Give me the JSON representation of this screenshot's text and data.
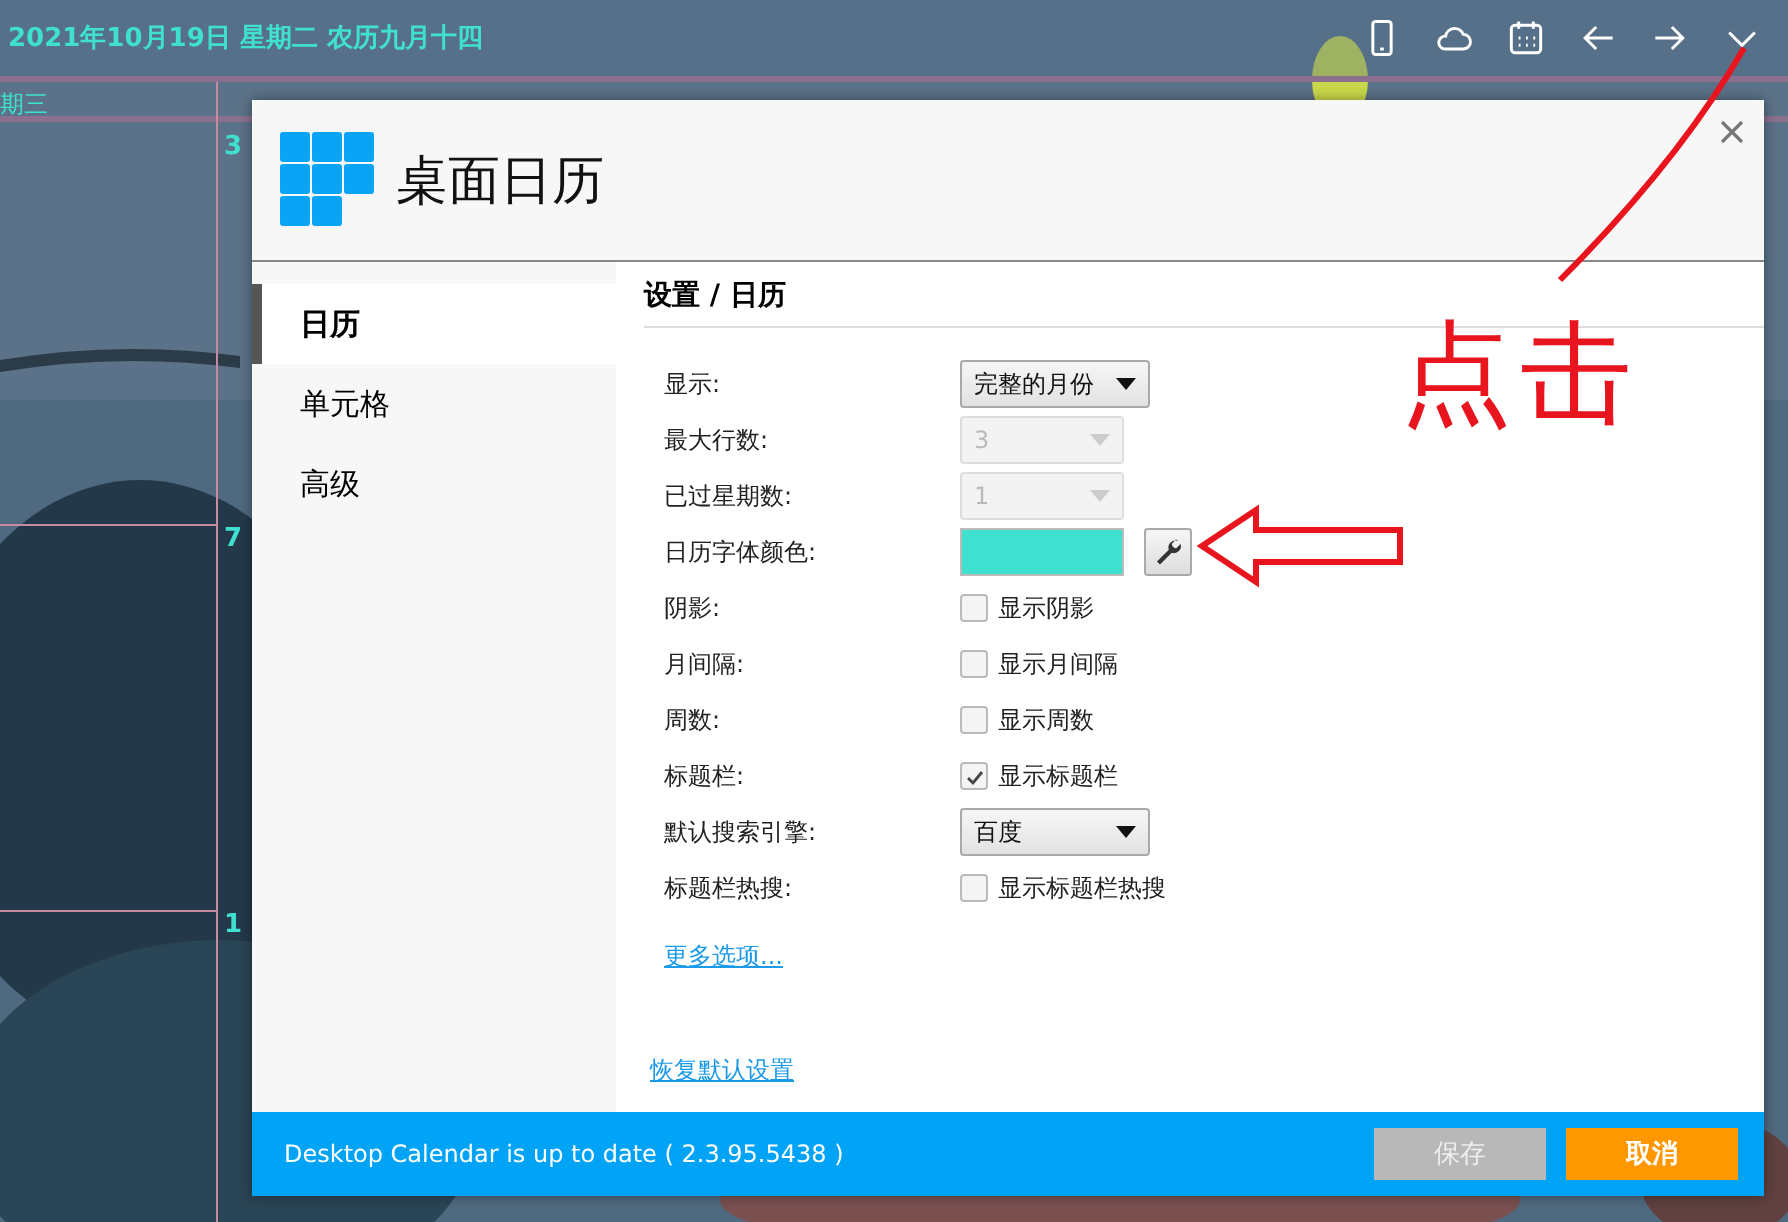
{
  "top_bar": {
    "date": "2021年10月19日 星期二 农历九月十四"
  },
  "calendar": {
    "weekday": "期三",
    "days": [
      "3",
      "7",
      "1"
    ]
  },
  "dialog": {
    "title": "桌面日历",
    "sidebar": [
      {
        "label": "日历",
        "selected": true
      },
      {
        "label": "单元格",
        "selected": false
      },
      {
        "label": "高级",
        "selected": false
      }
    ],
    "heading": "设置 / 日历",
    "settings": [
      {
        "label": "显示:",
        "kind": "select",
        "value": "完整的月份",
        "disabled": false
      },
      {
        "label": "最大行数:",
        "kind": "select",
        "value": "3",
        "disabled": true
      },
      {
        "label": "已过星期数:",
        "kind": "select",
        "value": "1",
        "disabled": true
      },
      {
        "label": "日历字体颜色:",
        "kind": "color",
        "color": "#40e0d0"
      },
      {
        "label": "阴影:",
        "kind": "checkbox",
        "text": "显示阴影",
        "checked": false
      },
      {
        "label": "月间隔:",
        "kind": "checkbox",
        "text": "显示月间隔",
        "checked": false
      },
      {
        "label": "周数:",
        "kind": "checkbox",
        "text": "显示周数",
        "checked": false
      },
      {
        "label": "标题栏:",
        "kind": "checkbox",
        "text": "显示标题栏",
        "checked": true
      },
      {
        "label": "默认搜索引擎:",
        "kind": "select",
        "value": "百度",
        "disabled": false
      },
      {
        "label": "标题栏热搜:",
        "kind": "checkbox",
        "text": "显示标题栏热搜",
        "checked": false
      }
    ],
    "more_link": "更多选项...",
    "reset_link": "恢复默认设置",
    "status": "Desktop Calendar is up to date ( 2.3.95.5438 )",
    "buttons": [
      {
        "label": "保存",
        "disabled": true
      },
      {
        "label": "取消",
        "disabled": false
      }
    ]
  },
  "annotation": {
    "text": "点击"
  }
}
